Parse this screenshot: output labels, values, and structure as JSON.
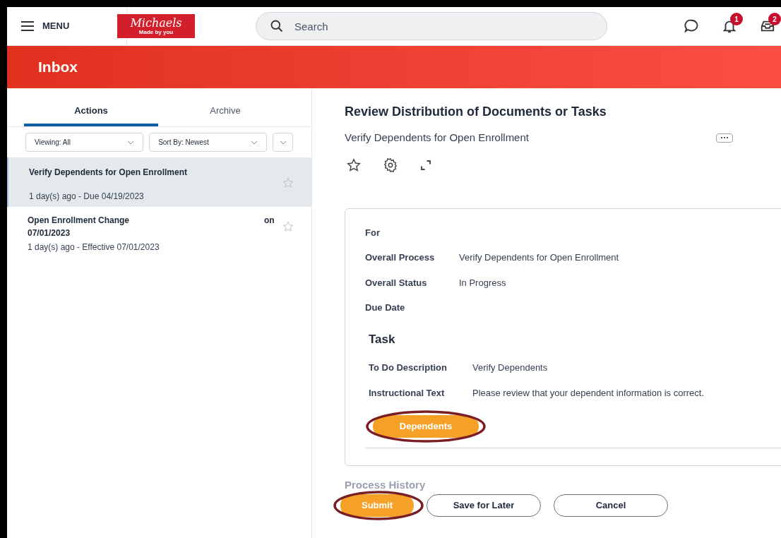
{
  "header": {
    "menu_label": "MENU",
    "logo": {
      "name": "Michaels",
      "tagline": "Made by you"
    },
    "search": {
      "placeholder": "Search"
    },
    "notifications": {
      "badge": "1"
    },
    "inbox": {
      "badge": "2"
    }
  },
  "banner": {
    "title": "Inbox"
  },
  "tabs": [
    {
      "label": "Actions",
      "selected": true
    },
    {
      "label": "Archive",
      "selected": false
    }
  ],
  "filters": [
    {
      "label": "Viewing: All"
    },
    {
      "label": "Sort By: Newest"
    }
  ],
  "inbox_items": [
    {
      "title": "Verify Dependents for Open Enrollment",
      "subtitle": "1 day(s) ago - Due 04/19/2023",
      "selected": true
    },
    {
      "title": "Open Enrollment Change",
      "title_suffix": "on",
      "title_line2": "07/01/2023",
      "subtitle": "1 day(s) ago - Effective 07/01/2023",
      "selected": false
    }
  ],
  "detail": {
    "title": "Review Distribution of Documents or Tasks",
    "subtitle": "Verify Dependents for Open Enrollment",
    "fields": [
      {
        "label": "For"
      },
      {
        "label": "Overall Process",
        "value": "Verify Dependents for Open Enrollment"
      },
      {
        "label": "Overall Status",
        "value": "In Progress"
      },
      {
        "label": "Due Date"
      }
    ],
    "task": {
      "heading": "Task",
      "fields": [
        {
          "label": "To Do Description",
          "value": "Verify Dependents"
        },
        {
          "label": "Instructional Text",
          "value": "Please review that your dependent information is correct."
        }
      ],
      "button": {
        "label": "Dependents",
        "highlighted": true
      }
    },
    "faded_section": "Process History"
  },
  "footer_buttons": [
    {
      "label": "Submit",
      "kind": "primary",
      "highlighted": true
    },
    {
      "label": "Save for Later",
      "kind": "secondary",
      "highlighted": false
    },
    {
      "label": "Cancel",
      "kind": "secondary",
      "highlighted": false
    }
  ]
}
